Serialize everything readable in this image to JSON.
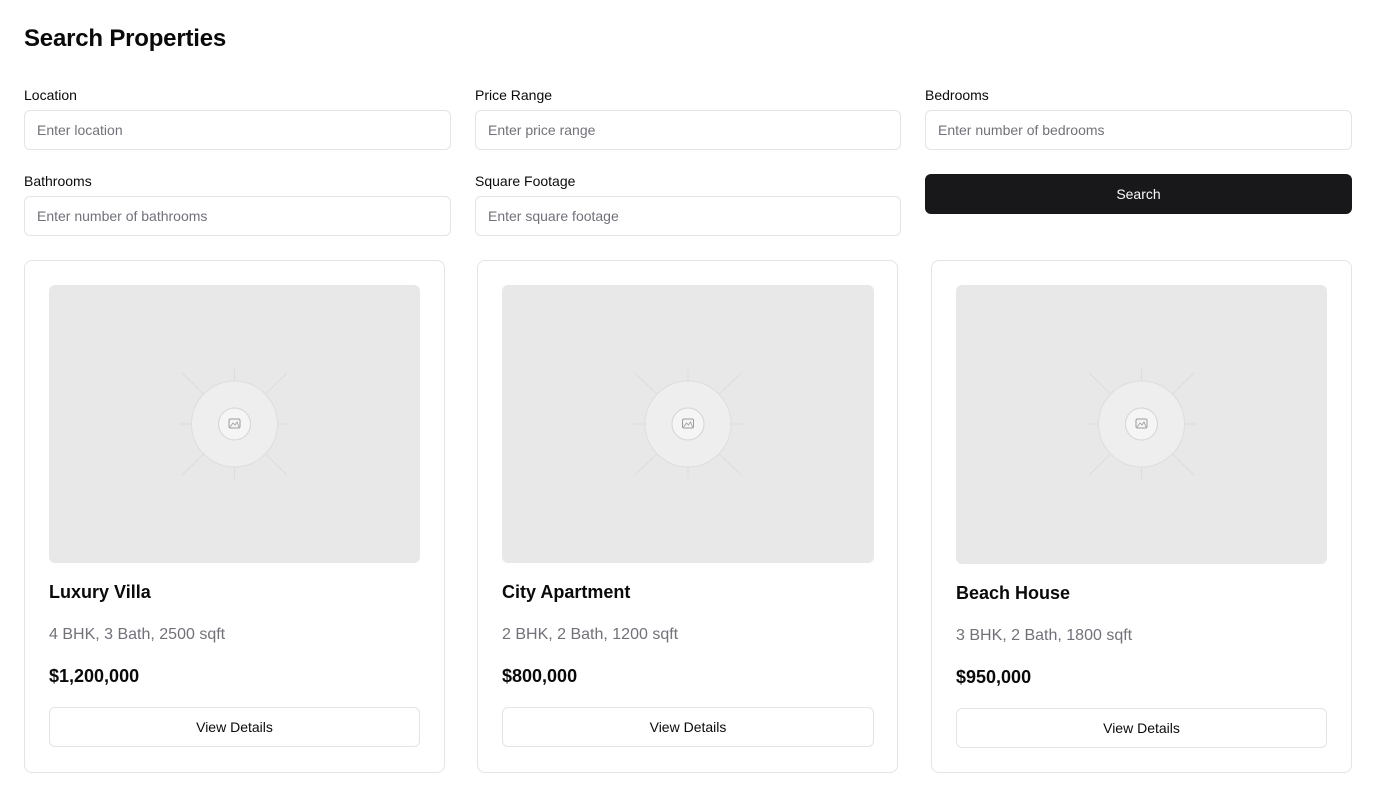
{
  "page": {
    "title": "Search Properties"
  },
  "search": {
    "location": {
      "label": "Location",
      "placeholder": "Enter location",
      "value": ""
    },
    "price_range": {
      "label": "Price Range",
      "placeholder": "Enter price range",
      "value": ""
    },
    "bedrooms": {
      "label": "Bedrooms",
      "placeholder": "Enter number of bedrooms",
      "value": ""
    },
    "bathrooms": {
      "label": "Bathrooms",
      "placeholder": "Enter number of bathrooms",
      "value": ""
    },
    "square_footage": {
      "label": "Square Footage",
      "placeholder": "Enter square footage",
      "value": ""
    },
    "button_label": "Search"
  },
  "properties": [
    {
      "title": "Luxury Villa",
      "specs": "4 BHK, 3 Bath, 2500 sqft",
      "price": "$1,200,000",
      "button_label": "View Details",
      "image_icon": "image-placeholder-icon"
    },
    {
      "title": "City Apartment",
      "specs": "2 BHK, 2 Bath, 1200 sqft",
      "price": "$800,000",
      "button_label": "View Details",
      "image_icon": "image-placeholder-icon"
    },
    {
      "title": "Beach House",
      "specs": "3 BHK, 2 Bath, 1800 sqft",
      "price": "$950,000",
      "button_label": "View Details",
      "image_icon": "image-placeholder-icon"
    }
  ],
  "colors": {
    "primary_button": "#18181b",
    "border": "#e4e4e7",
    "muted_text": "#71717a",
    "image_placeholder": "#e8e8e8"
  }
}
